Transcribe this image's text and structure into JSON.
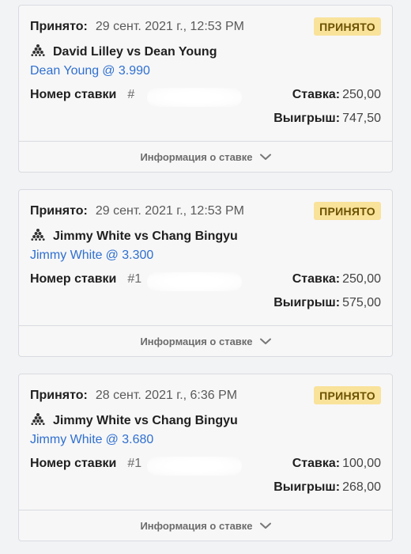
{
  "bets": [
    {
      "accepted_label": "Принято:",
      "datetime": "29 сент. 2021 г., 12:53 PM",
      "status": "ПРИНЯТО",
      "sport_icon": "snooker-balls-icon",
      "match": "David Lilley vs Dean Young",
      "selection": "Dean Young",
      "odds": "@ 3.990",
      "bet_number_label": "Номер ставки",
      "bet_number": "#",
      "stake_label": "Ставка:",
      "stake": "250,00",
      "payout_label": "Выигрыш:",
      "payout": "747,50",
      "info_label": "Информация о ставке"
    },
    {
      "accepted_label": "Принято:",
      "datetime": "29 сент. 2021 г., 12:53 PM",
      "status": "ПРИНЯТО",
      "sport_icon": "snooker-balls-icon",
      "match": "Jimmy White vs Chang Bingyu",
      "selection": "Jimmy White",
      "odds": "@ 3.300",
      "bet_number_label": "Номер ставки",
      "bet_number": "#1",
      "stake_label": "Ставка:",
      "stake": "250,00",
      "payout_label": "Выигрыш:",
      "payout": "575,00",
      "info_label": "Информация о ставке"
    },
    {
      "accepted_label": "Принято:",
      "datetime": "28 сент. 2021 г., 6:36 PM",
      "status": "ПРИНЯТО",
      "sport_icon": "snooker-balls-icon",
      "match": "Jimmy White vs Chang Bingyu",
      "selection": "Jimmy White",
      "odds": "@ 3.680",
      "bet_number_label": "Номер ставки",
      "bet_number": "#1",
      "stake_label": "Ставка:",
      "stake": "100,00",
      "payout_label": "Выигрыш:",
      "payout": "268,00",
      "info_label": "Информация о ставке"
    }
  ],
  "colors": {
    "badge_bg": "#f9e29a",
    "link": "#2f6fcf",
    "card_bg": "#f7f7f8",
    "border": "#d9dbe0"
  }
}
